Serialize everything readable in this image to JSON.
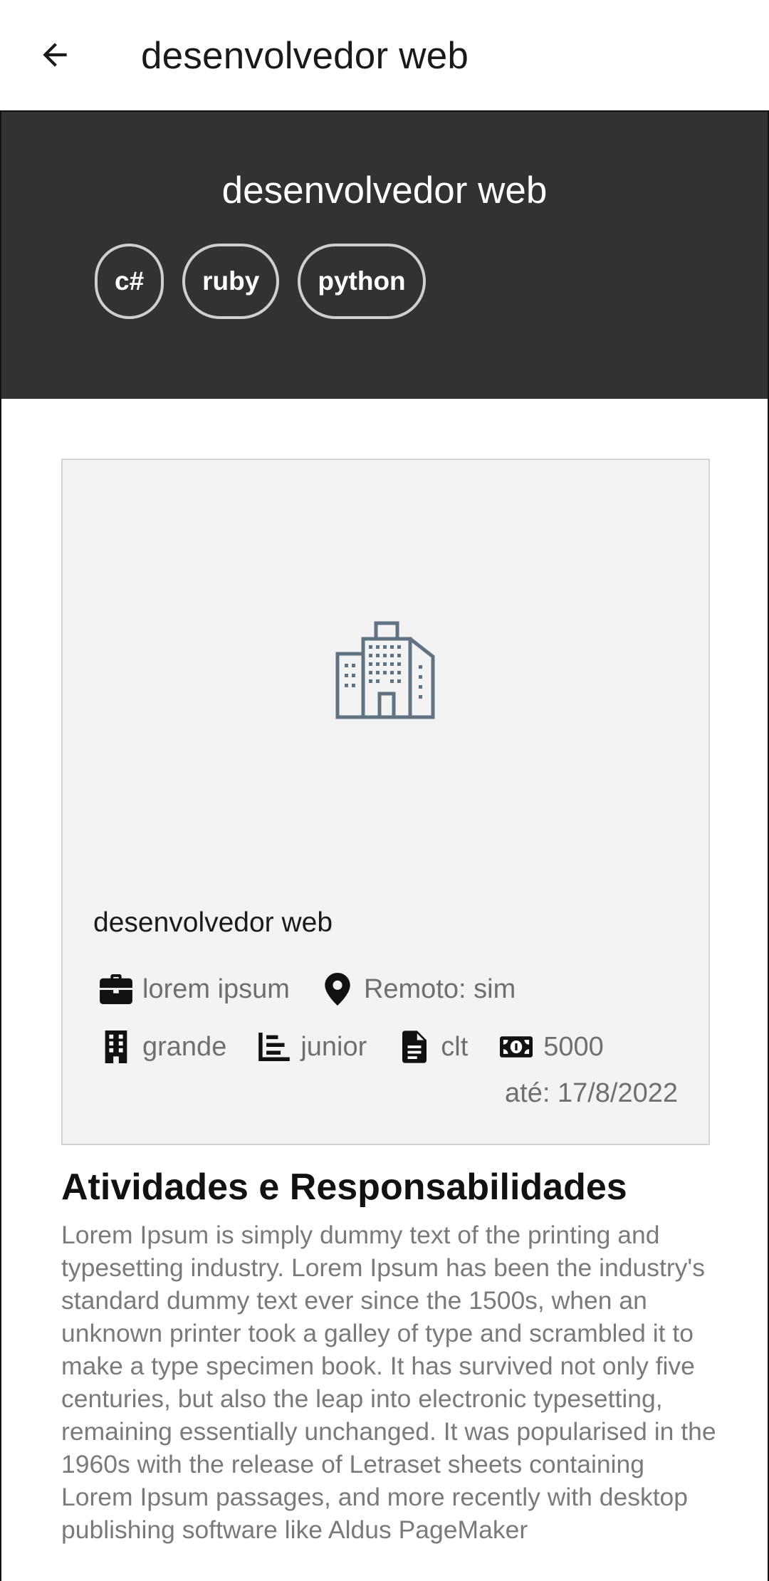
{
  "appbar": {
    "title": "desenvolvedor web"
  },
  "hero": {
    "title": "desenvolvedor web",
    "tags": [
      "c#",
      "ruby",
      "python"
    ]
  },
  "card": {
    "title": "desenvolvedor web",
    "company": "lorem ipsum",
    "remote": "Remoto: sim",
    "size": "grande",
    "level": "junior",
    "contract": "clt",
    "salary": "5000",
    "deadline": "até: 17/8/2022"
  },
  "section": {
    "title": "Atividades e Responsabilidades",
    "description": "Lorem Ipsum is simply dummy text of the printing and typesetting industry. Lorem Ipsum has been the industry's standard dummy text ever since the 1500s, when an unknown printer took a galley of type and scrambled it to make a type specimen book. It has survived not only five centuries, but also the leap into electronic typesetting, remaining essentially unchanged. It was popularised in the 1960s with the release of Letraset sheets containing Lorem Ipsum passages, and more recently with desktop publishing software like Aldus PageMaker"
  },
  "icons": {
    "back": "arrow-left-icon",
    "building": "building-icon",
    "company": "briefcase-icon",
    "location": "map-pin-icon",
    "size": "office-building-icon",
    "level": "bar-chart-icon",
    "contract": "document-icon",
    "salary": "money-icon"
  },
  "colors": {
    "hero_bg": "#323232",
    "card_bg": "#f3f3f3",
    "icon_slate": "#5f7382"
  }
}
